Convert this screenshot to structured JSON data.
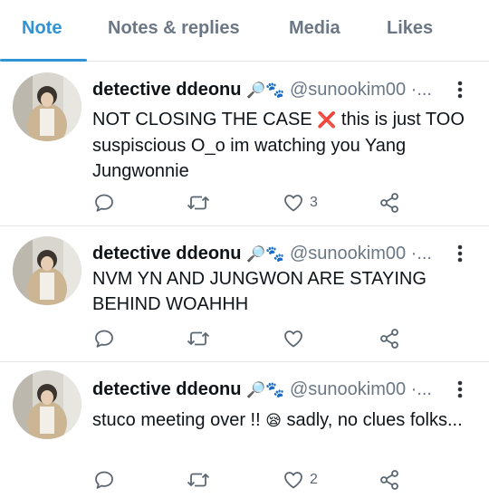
{
  "tabs": [
    {
      "label": "Note"
    },
    {
      "label": "Notes & replies"
    },
    {
      "label": "Media"
    },
    {
      "label": "Likes"
    }
  ],
  "posts": [
    {
      "name": "detective ddeonu",
      "name_emoji": "🔎🐾",
      "handle": "@sunookim00 ·...",
      "text_parts": [
        "NOT CLOSING THE CASE ",
        "❌",
        " this is just TOO suspiscious O_o im watching you Yang Jungwonnie"
      ],
      "likes": "3"
    },
    {
      "name": "detective ddeonu",
      "name_emoji": "🔎🐾",
      "handle": "@sunookim00 ·...",
      "text_parts": [
        "NVM YN AND JUNGWON ARE STAYING BEHIND WOAHHH"
      ],
      "likes": ""
    },
    {
      "name": "detective ddeonu",
      "name_emoji": "🔎🐾",
      "handle": "@sunookim00 ·...",
      "text_parts": [
        "stuco meeting over !! ",
        "😪",
        " sadly, no clues folks..."
      ],
      "likes": "2"
    }
  ],
  "icons": {
    "reply": "speech-bubble-icon",
    "repost": "repost-arrows-icon",
    "like": "heart-outline-icon",
    "share": "share-nodes-icon",
    "more": "vertical-ellipsis-icon"
  },
  "colors": {
    "accent": "#2f93d6",
    "muted": "#6b7785",
    "divider": "#e3e6e8"
  }
}
